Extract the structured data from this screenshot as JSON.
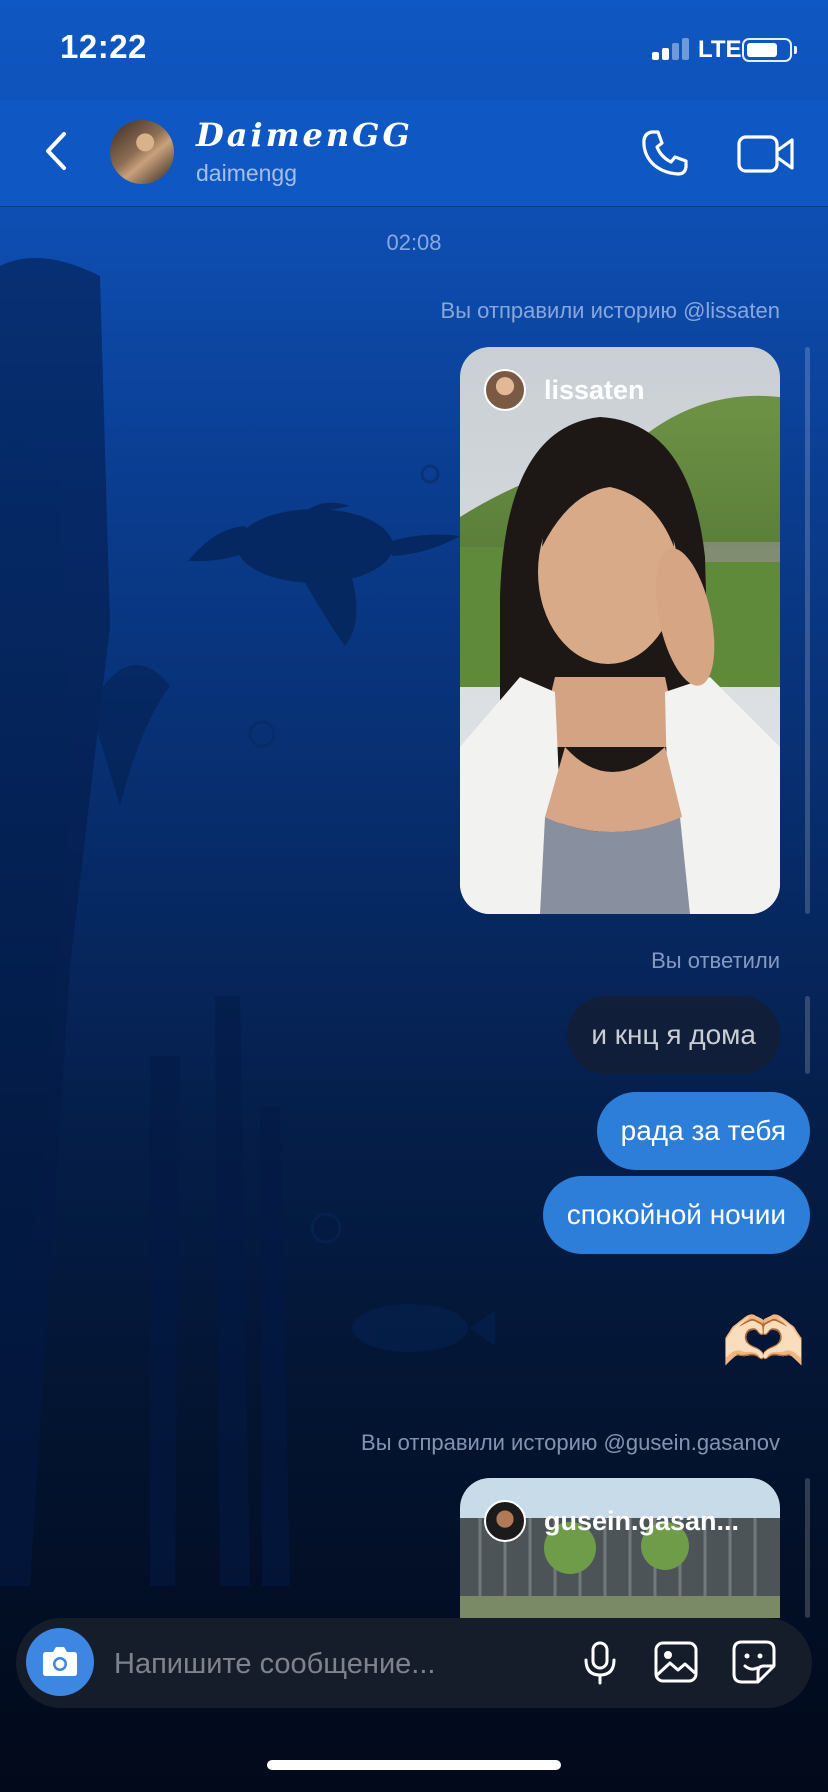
{
  "status_bar": {
    "time": "12:22",
    "network": "LTE",
    "battery_level": 0.75,
    "signal_bars": 2
  },
  "header": {
    "contact_name": "DaimenGG",
    "contact_handle": "daimengg",
    "icons": {
      "back": "chevron-left-icon",
      "call": "phone-icon",
      "video": "video-camera-icon"
    }
  },
  "chat": {
    "timestamp": "02:08",
    "story_1": {
      "caption": "Вы отправили историю @lissaten",
      "owner": "lissaten"
    },
    "reply_caption": "Вы ответили",
    "messages": [
      {
        "text": "и кнц я дома",
        "style": "reply-dark"
      },
      {
        "text": "рада за тебя",
        "style": "sent-blue"
      },
      {
        "text": "спокойной ночии",
        "style": "sent-blue"
      }
    ],
    "emoji_message": "🫶🏻",
    "story_2": {
      "caption": "Вы отправили историю @gusein.gasanov",
      "owner": "gusein.gasan..."
    }
  },
  "composer": {
    "placeholder": "Напишите сообщение...",
    "icons": {
      "camera": "camera-icon",
      "mic": "microphone-icon",
      "gallery": "image-icon",
      "sticker": "sticker-icon"
    }
  },
  "colors": {
    "header": "#0f57c2",
    "sent_bubble": "#2d7ed8",
    "camera_button": "#3d86e2"
  }
}
